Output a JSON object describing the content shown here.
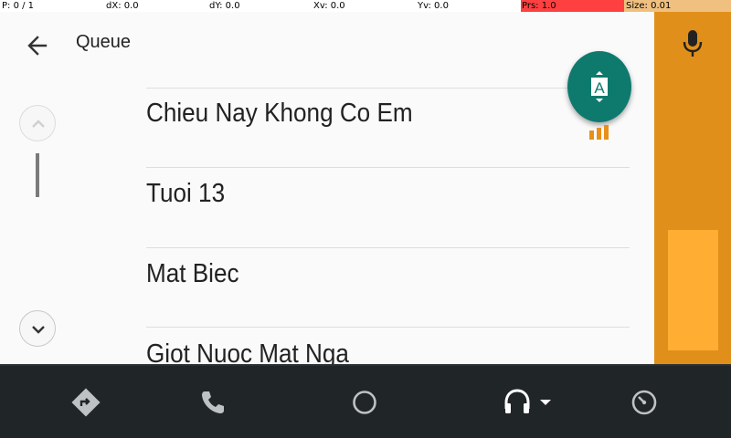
{
  "debug_bar": {
    "p": "P: 0 / 1",
    "dx": "dX: 0.0",
    "dy": "dY: 0.0",
    "xv": "Xv: 0.0",
    "yv": "Yv: 0.0",
    "prs": "Prs: 1.0",
    "size": "Size: 0.01"
  },
  "header": {
    "title": "Queue"
  },
  "queue": {
    "items": [
      {
        "title": "Chieu Nay Khong Co Em",
        "now_playing": true
      },
      {
        "title": "Tuoi 13"
      },
      {
        "title": "Mat Biec"
      },
      {
        "title": "Giot Nuoc Mat Nga"
      }
    ]
  },
  "icons": {
    "back": "arrow-back-icon",
    "scroll_up": "chevron-up-icon",
    "scroll_down": "chevron-down-icon",
    "fab": "alphabet-scroll-icon",
    "fab_letter": "A",
    "mic": "microphone-icon",
    "equalizer": "equalizer-icon",
    "nav": [
      "navigation-icon",
      "phone-icon",
      "home-icon",
      "headphones-icon",
      "dashboard-icon"
    ]
  },
  "colors": {
    "accent_orange": "#e0901a",
    "fab_teal": "#0e7a6d",
    "nav_bar": "#202528"
  }
}
